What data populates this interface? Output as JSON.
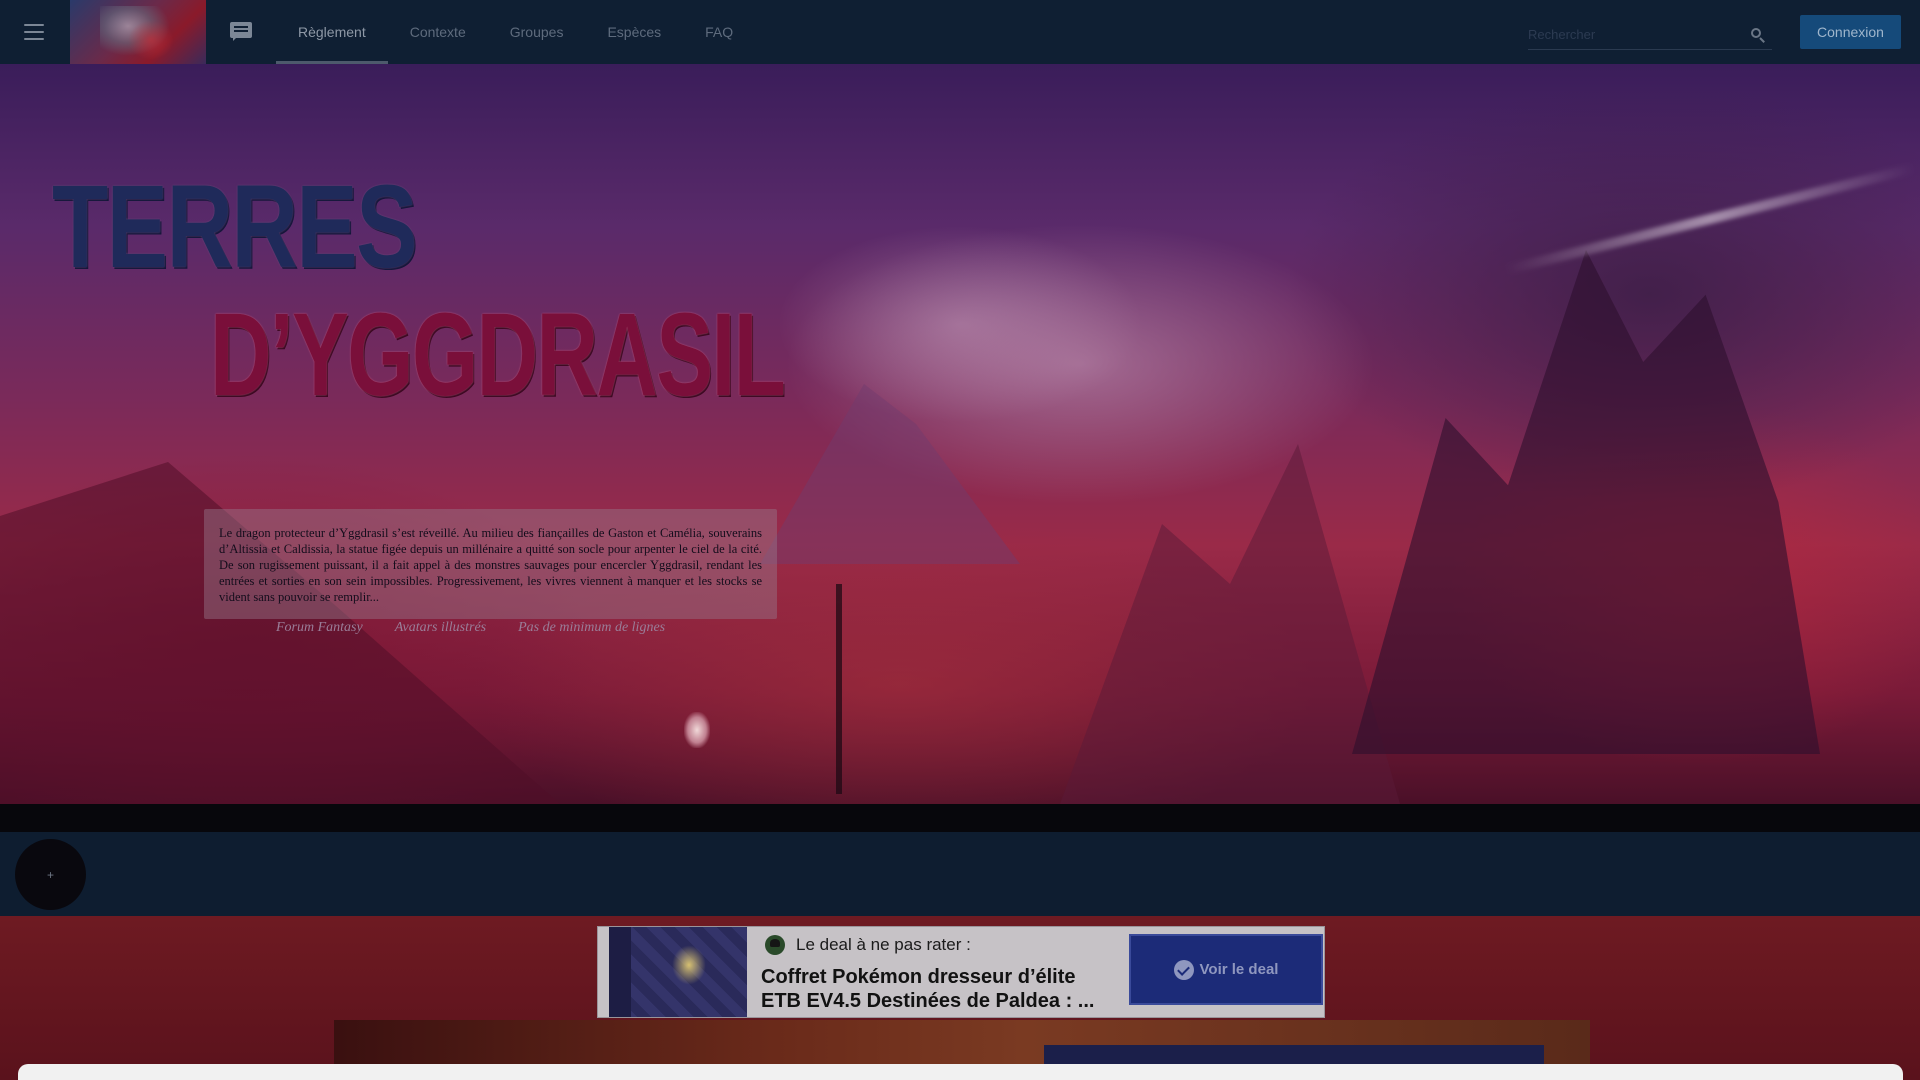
{
  "navbar": {
    "tabs": [
      {
        "label": "Règlement",
        "active": true
      },
      {
        "label": "Contexte",
        "active": false
      },
      {
        "label": "Groupes",
        "active": false
      },
      {
        "label": "Espèces",
        "active": false
      },
      {
        "label": "FAQ",
        "active": false
      }
    ],
    "search_placeholder": "Rechercher",
    "login_label": "Connexion",
    "icons": {
      "menu": "hamburger-menu-icon",
      "chat": "chat-icon",
      "search": "search-icon"
    }
  },
  "hero": {
    "title_line1": "TERRES",
    "title_line2": "D’YGGDRASIL",
    "synopsis": "Le dragon protecteur d’Yggdrasil s’est réveillé. Au milieu des fiançailles de Gaston et Camélia, souverains d’Altissia et Caldissia, la statue figée depuis un millénaire a quitté son socle pour arpenter le ciel de la cité. De son rugissement puissant, il a fait appel à des monstres sauvages pour encercler Yggdrasil, rendant les entrées et sorties en son sein impossibles. Progressivement, les vivres viennent à manquer et les stocks se vident sans pouvoir se remplir...",
    "tags": [
      "Forum Fantasy",
      "Avatars illustrés",
      "Pas de minimum de lignes"
    ]
  },
  "fab_label": "+",
  "deal": {
    "label": "Le deal à ne pas rater :",
    "title": "Coffret Pokémon dresseur d’élite ETB EV4.5 Destinées de Paldea : ...",
    "button_label": "Voir le deal"
  },
  "colors": {
    "navbar_bg": "#0f1f33",
    "login_button": "#154a7a",
    "deal_button": "#1c2b78",
    "title_blue": "#1f2a5a",
    "title_red": "#7a0f3a"
  }
}
